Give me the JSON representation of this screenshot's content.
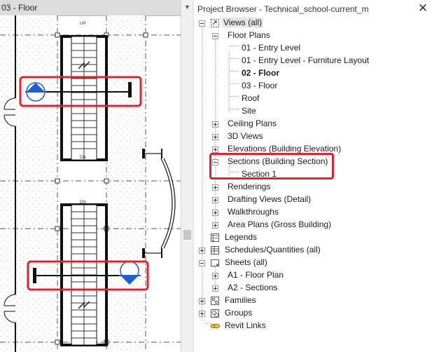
{
  "view": {
    "tab_label": "03 - Floor",
    "stair_up": "UP",
    "stair_dn": "DN",
    "stair_dn2": "DN"
  },
  "browser": {
    "title": "Project Browser - Technical_school-current_m",
    "close_glyph": "✕",
    "nodes": [
      {
        "label": "Views (all)"
      },
      {
        "label": "Floor Plans"
      },
      {
        "label": "01 - Entry Level"
      },
      {
        "label": "01 - Entry Level - Furniture Layout"
      },
      {
        "label": "02 - Floor"
      },
      {
        "label": "03 - Floor"
      },
      {
        "label": "Roof"
      },
      {
        "label": "Site"
      },
      {
        "label": "Ceiling Plans"
      },
      {
        "label": "3D Views"
      },
      {
        "label": "Elevations (Building Elevation)"
      },
      {
        "label": "Sections (Building Section)"
      },
      {
        "label": "Section 1"
      },
      {
        "label": "Renderings"
      },
      {
        "label": "Drafting Views (Detail)"
      },
      {
        "label": "Walkthroughs"
      },
      {
        "label": "Area Plans (Gross Building)"
      },
      {
        "label": "Legends"
      },
      {
        "label": "Schedules/Quantities (all)"
      },
      {
        "label": "Sheets (all)"
      },
      {
        "label": "A1 - Floor Plan"
      },
      {
        "label": "A2 - Sections"
      },
      {
        "label": "Families"
      },
      {
        "label": "Groups"
      },
      {
        "label": "Revit Links"
      }
    ]
  },
  "colors": {
    "highlight": "#e0232e",
    "section_marker": "#1f5fd6",
    "wall": "#111111"
  }
}
